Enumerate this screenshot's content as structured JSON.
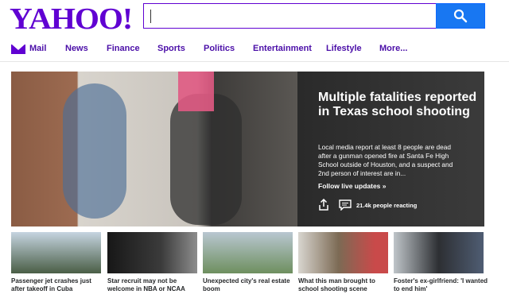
{
  "header": {
    "logo": "YAHOO!",
    "search_value": "",
    "search_icon": "search-icon"
  },
  "nav": [
    {
      "label": "Mail",
      "icon": "mail-icon"
    },
    {
      "label": "News"
    },
    {
      "label": "Finance"
    },
    {
      "label": "Sports"
    },
    {
      "label": "Politics"
    },
    {
      "label": "Entertainment"
    },
    {
      "label": "Lifestyle"
    },
    {
      "label": "More..."
    }
  ],
  "hero": {
    "title": "Multiple fatalities reported in Texas school shooting",
    "description": "Local media report at least 8 people are dead after a gunman opened fire at Santa Fe High School outside of Houston, and a suspect and 2nd person of interest are in...",
    "cta": "Follow live updates »",
    "reactions": "21.4k people reacting",
    "share_icon": "share-icon",
    "comment_icon": "comment-icon"
  },
  "stories": [
    {
      "caption": "Passenger jet crashes just after takeoff in Cuba"
    },
    {
      "caption": "Star recruit may not be welcome in NBA or NCAA"
    },
    {
      "caption": "Unexpected city's real estate boom"
    },
    {
      "caption": "What this man brought to school shooting scene"
    },
    {
      "caption": "Foster's ex-girlfriend: 'I wanted to end him'"
    }
  ],
  "colors": {
    "brand": "#6001d2",
    "search_button": "#1877f2",
    "nav_text": "#4b0fa8",
    "hero_panel": "#333333"
  }
}
